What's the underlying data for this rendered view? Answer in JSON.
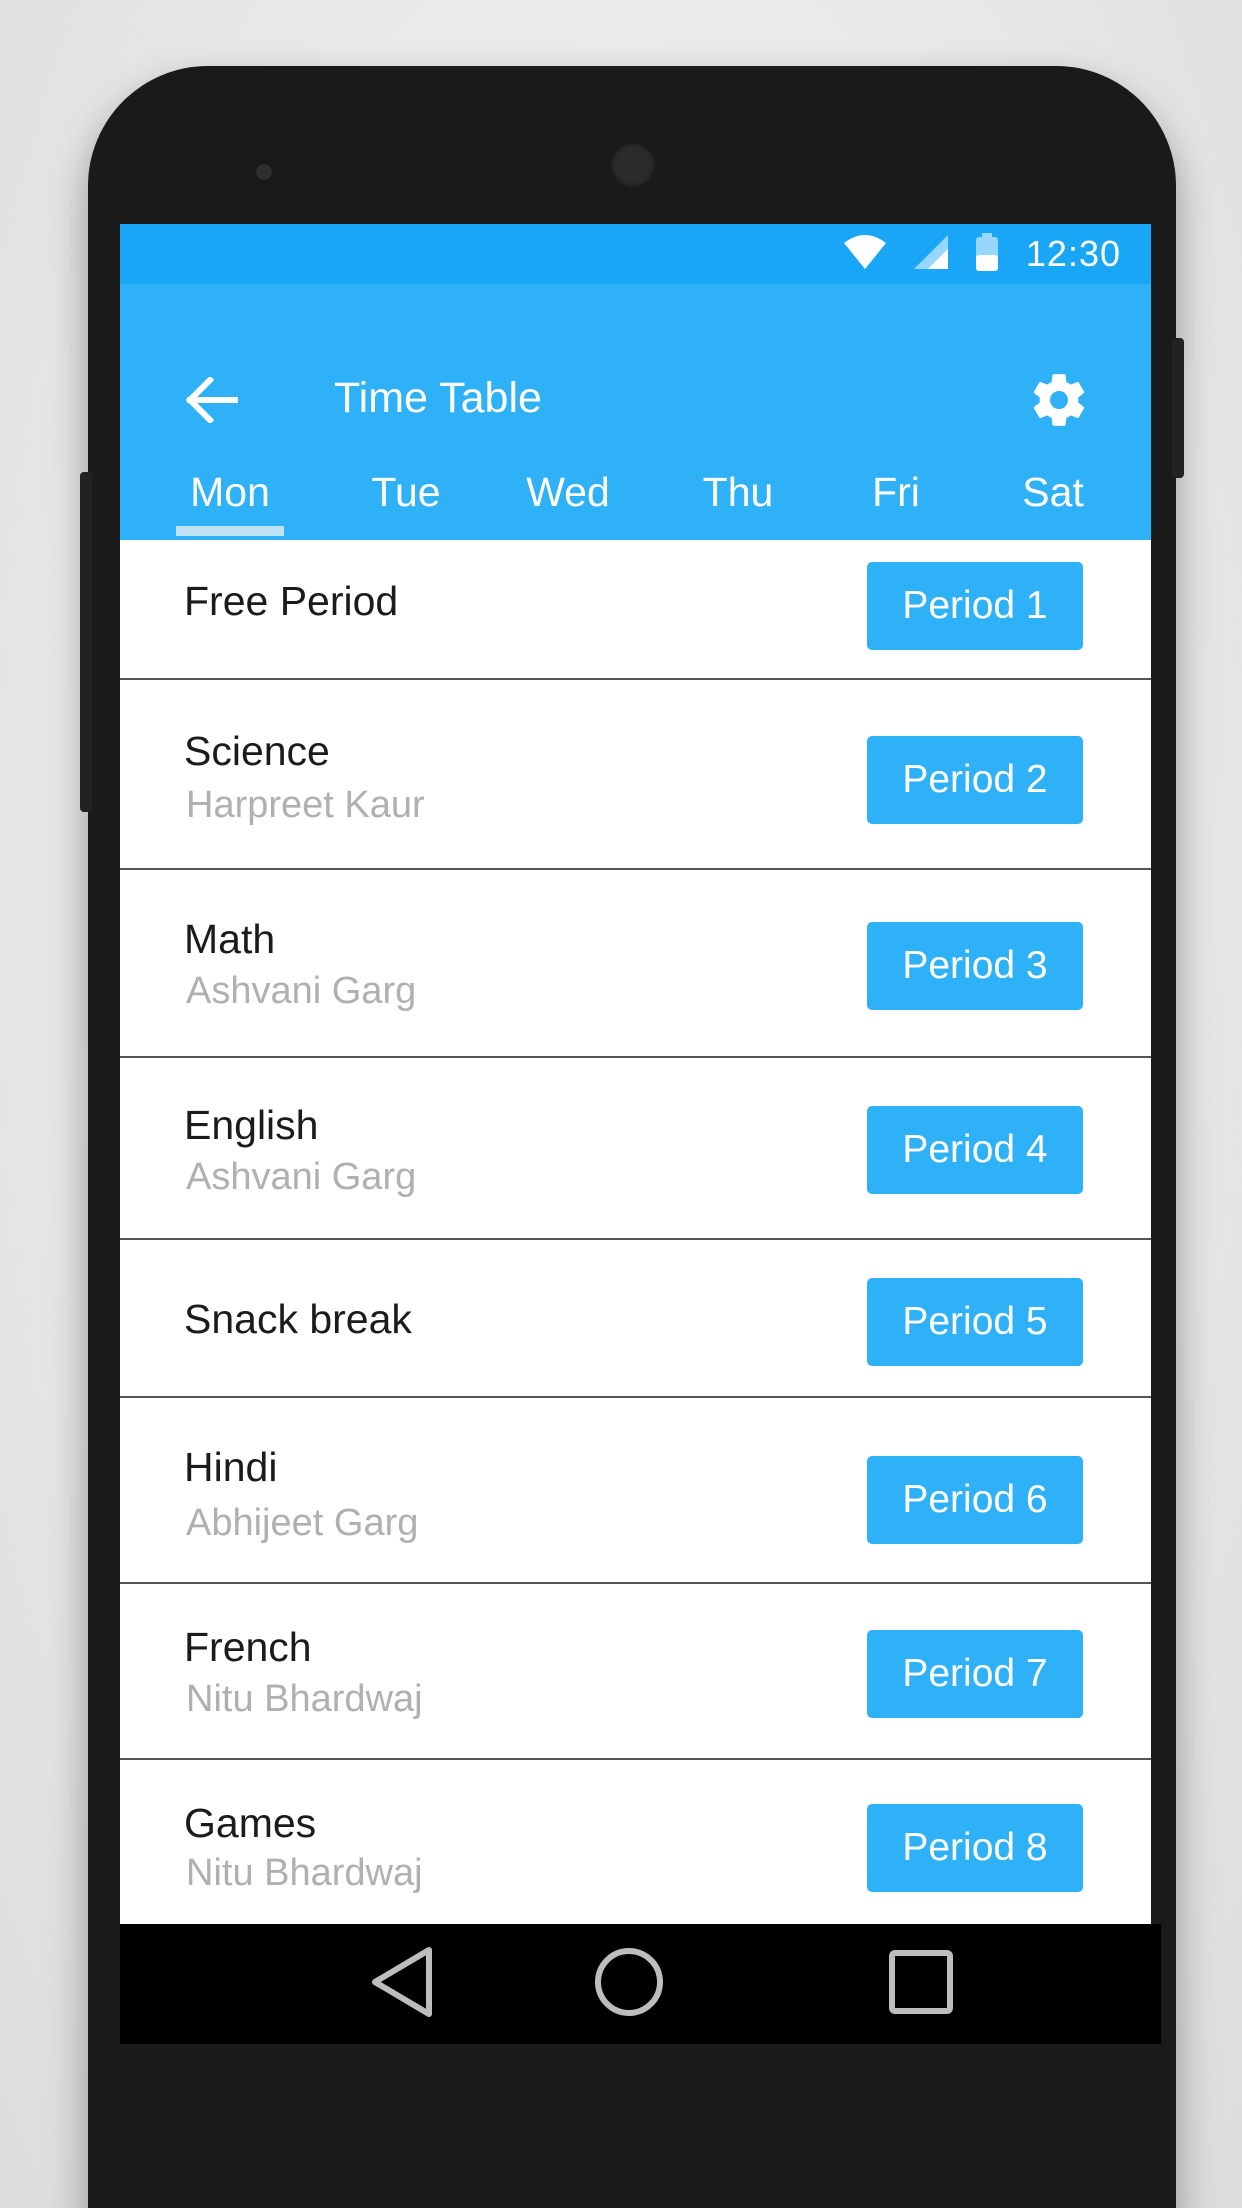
{
  "status_bar": {
    "time": "12:30",
    "icons": [
      "wifi-icon",
      "signal-icon",
      "battery-icon"
    ]
  },
  "app_bar": {
    "title": "Time Table",
    "back_icon": "arrow-left-icon",
    "settings_icon": "gear-icon"
  },
  "tabs": [
    {
      "label": "Mon",
      "selected": true
    },
    {
      "label": "Tue",
      "selected": false
    },
    {
      "label": "Wed",
      "selected": false
    },
    {
      "label": "Thu",
      "selected": false
    },
    {
      "label": "Fri",
      "selected": false
    },
    {
      "label": "Sat",
      "selected": false
    }
  ],
  "periods": [
    {
      "subject": "Free Period",
      "teacher": "",
      "label": "Period 1"
    },
    {
      "subject": "Science",
      "teacher": "Harpreet Kaur",
      "label": "Period 2"
    },
    {
      "subject": "Math",
      "teacher": "Ashvani Garg",
      "label": "Period 3"
    },
    {
      "subject": "English",
      "teacher": "Ashvani Garg",
      "label": "Period 4"
    },
    {
      "subject": "Snack break",
      "teacher": "",
      "label": "Period 5"
    },
    {
      "subject": "Hindi",
      "teacher": "Abhijeet Garg",
      "label": "Period 6"
    },
    {
      "subject": "French",
      "teacher": "Nitu Bhardwaj",
      "label": "Period 7"
    },
    {
      "subject": "Games",
      "teacher": "Nitu Bhardwaj",
      "label": "Period 8"
    }
  ],
  "nav_bar": {
    "icons": [
      "back-triangle-icon",
      "home-circle-icon",
      "recents-square-icon"
    ]
  },
  "colors": {
    "status_bar": "#19a6f6",
    "app_bar": "#2eb1f7",
    "period_button": "#2eb1f7",
    "teacher_text": "#b0b0b0"
  }
}
